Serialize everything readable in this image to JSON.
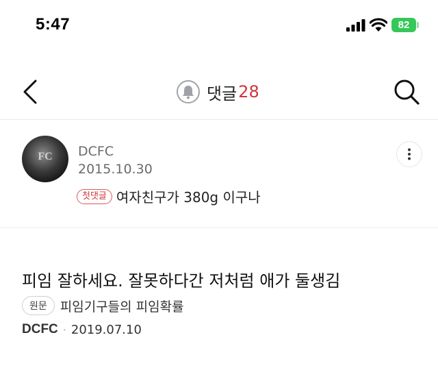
{
  "status_bar": {
    "time": "5:47",
    "battery": "82",
    "icons": [
      "signal-icon",
      "wifi-icon",
      "battery-icon"
    ]
  },
  "header": {
    "title": "댓글",
    "count": "28",
    "count_color": "#d0343b",
    "icons": [
      "back-arrow-icon",
      "bell-icon",
      "search-icon"
    ]
  },
  "comment": {
    "author": "DCFC",
    "date": "2015.10.30",
    "badge": "첫댓글",
    "badge_color": "#d0343b",
    "text": "여자친구가 380g 이구나",
    "avatar_text": "FC",
    "icons": [
      "more-vertical-icon"
    ]
  },
  "post": {
    "title": "피임 잘하세요. 잘못하다간 저처럼 애가 둘생김",
    "original_badge": "원문",
    "source_title": "피임기구들의 피임확률",
    "author": "DCFC",
    "separator": "·",
    "date": "2019.07.10"
  }
}
